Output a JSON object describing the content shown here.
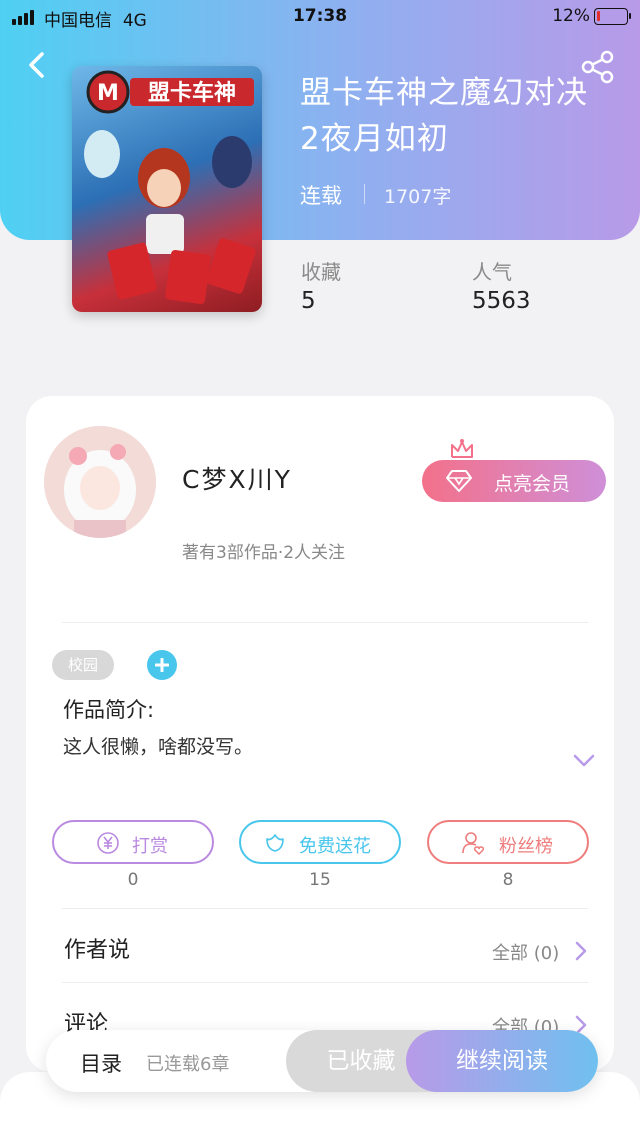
{
  "status_bar": {
    "carrier": "中国电信",
    "network": "4G",
    "time": "17:38",
    "battery": "12%",
    "battery_level": 0.12
  },
  "book": {
    "title": "盟卡车神之魔幻对决2夜月如初",
    "status": "连载",
    "word_count": "1707字",
    "cover_title": "盟卡车神",
    "stats": [
      {
        "label": "收藏",
        "value": "5"
      },
      {
        "label": "人气",
        "value": "5563"
      }
    ]
  },
  "author": {
    "name": "C梦X川Y",
    "stats": "著有3部作品·2人关注",
    "vip_label": "点亮会员"
  },
  "tags": [
    "校园"
  ],
  "intro": {
    "label": "作品简介:",
    "text": "这人很懒，啥都没写。"
  },
  "actions": [
    {
      "label": "打赏",
      "count": "0",
      "color": "#b98ae0",
      "icon": "yen-coin-icon"
    },
    {
      "label": "免费送花",
      "count": "15",
      "color": "#49c6ec",
      "icon": "flower-icon"
    },
    {
      "label": "粉丝榜",
      "count": "8",
      "color": "#ef7d7d",
      "icon": "fan-user-icon"
    }
  ],
  "sections": [
    {
      "title": "作者说",
      "more": "全部 (0)"
    },
    {
      "title": "评论",
      "more": "全部 (0)"
    }
  ],
  "bottom_bar": {
    "toc_label": "目录",
    "toc_sub": "已连载6章",
    "collected_label": "已收藏",
    "continue_label": "继续阅读"
  },
  "colors": {
    "accent_purple": "#b89ae8",
    "accent_cyan": "#4fd0f3",
    "vip_pink": "#f3718a"
  }
}
